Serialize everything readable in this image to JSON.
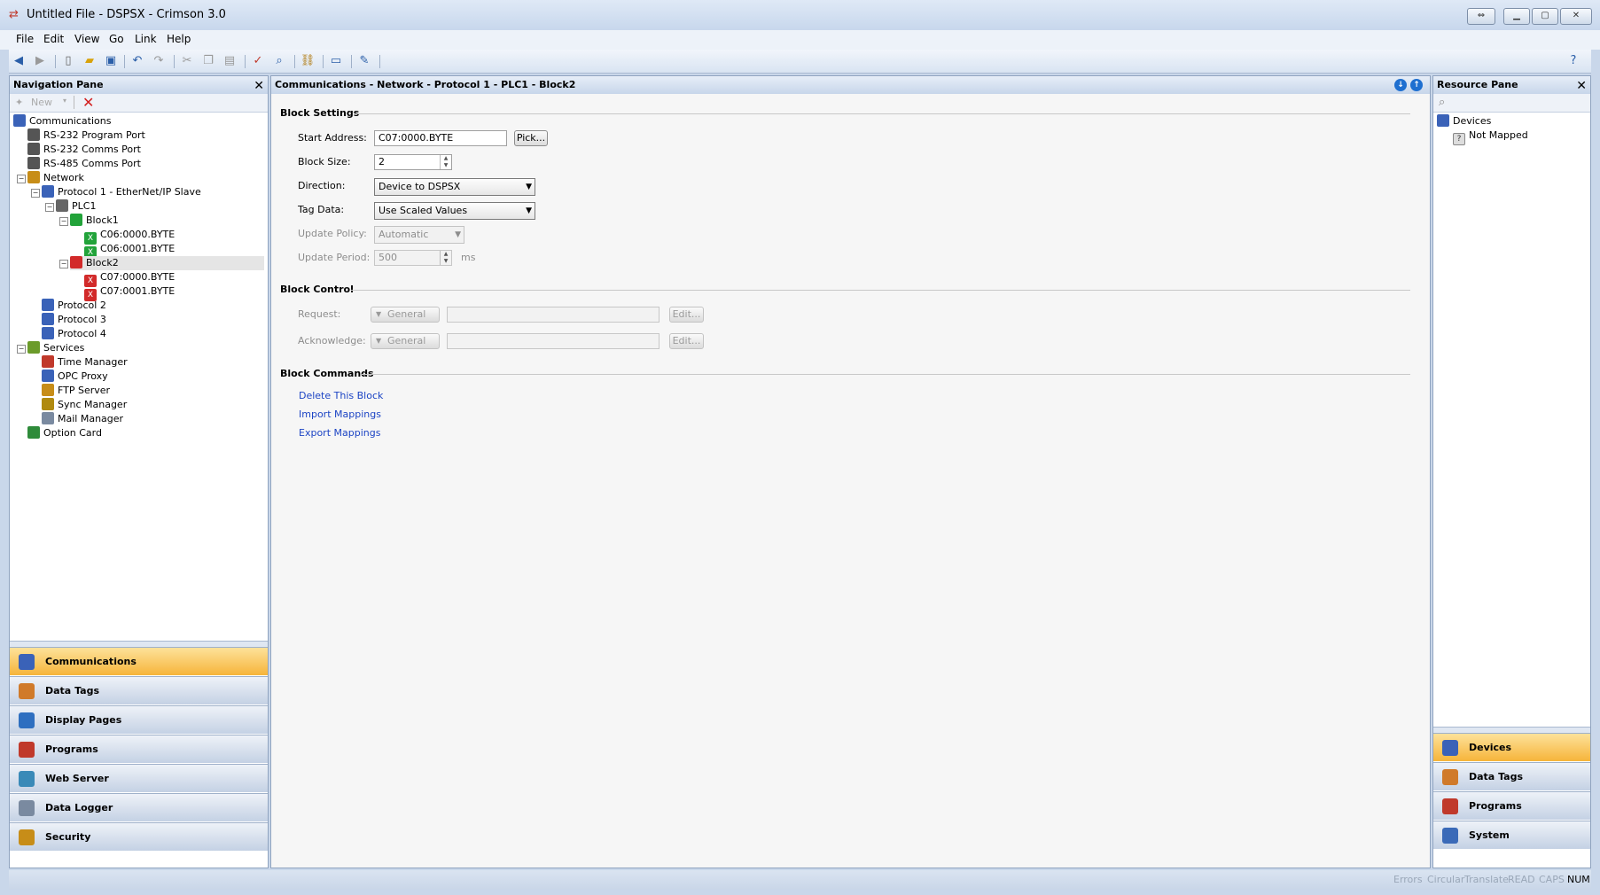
{
  "window": {
    "title": "Untitled File - DSPSX - Crimson 3.0"
  },
  "menu": [
    "File",
    "Edit",
    "View",
    "Go",
    "Link",
    "Help"
  ],
  "toolbar": {
    "icons": [
      "back-icon",
      "forward-icon",
      "new-file-icon",
      "open-folder-icon",
      "save-icon",
      "undo-icon",
      "redo-icon",
      "cut-icon",
      "copy-icon",
      "paste-icon",
      "spell-check-icon",
      "find-icon",
      "link-icon",
      "monitor-icon",
      "pencil-icon",
      "help-icon"
    ]
  },
  "nav_pane": {
    "title": "Navigation Pane",
    "new_label": "New",
    "tree": [
      {
        "label": "Communications",
        "level": 0,
        "icon": "comms-icon",
        "expander": ""
      },
      {
        "label": "RS-232 Program Port",
        "level": 1,
        "icon": "port-icon",
        "expander": ""
      },
      {
        "label": "RS-232 Comms Port",
        "level": 1,
        "icon": "port-icon",
        "expander": ""
      },
      {
        "label": "RS-485 Comms Port",
        "level": 1,
        "icon": "port-icon",
        "expander": ""
      },
      {
        "label": "Network",
        "level": 1,
        "icon": "network-icon",
        "expander": "−"
      },
      {
        "label": "Protocol 1 - EtherNet/IP Slave",
        "level": 2,
        "icon": "protocol-icon",
        "expander": "−"
      },
      {
        "label": "PLC1",
        "level": 3,
        "icon": "plc-icon",
        "expander": "−"
      },
      {
        "label": "Block1",
        "level": 4,
        "icon": "block-green-icon",
        "expander": "−"
      },
      {
        "label": "C06:0000.BYTE",
        "level": 5,
        "icon": "mapped-green-icon",
        "expander": ""
      },
      {
        "label": "C06:0001.BYTE",
        "level": 5,
        "icon": "mapped-green-icon",
        "expander": ""
      },
      {
        "label": "Block2",
        "level": 4,
        "icon": "block-red-icon",
        "expander": "−"
      },
      {
        "label": "C07:0000.BYTE",
        "level": 5,
        "icon": "mapped-red-icon",
        "expander": ""
      },
      {
        "label": "C07:0001.BYTE",
        "level": 5,
        "icon": "mapped-red-icon",
        "expander": ""
      },
      {
        "label": "Protocol 2",
        "level": 2,
        "icon": "protocol-icon",
        "expander": ""
      },
      {
        "label": "Protocol 3",
        "level": 2,
        "icon": "protocol-icon",
        "expander": ""
      },
      {
        "label": "Protocol 4",
        "level": 2,
        "icon": "protocol-icon",
        "expander": ""
      },
      {
        "label": "Services",
        "level": 1,
        "icon": "services-icon",
        "expander": "−"
      },
      {
        "label": "Time Manager",
        "level": 2,
        "icon": "clock-icon",
        "expander": ""
      },
      {
        "label": "OPC Proxy",
        "level": 2,
        "icon": "opc-icon",
        "expander": ""
      },
      {
        "label": "FTP Server",
        "level": 2,
        "icon": "ftp-icon",
        "expander": ""
      },
      {
        "label": "Sync Manager",
        "level": 2,
        "icon": "sync-icon",
        "expander": ""
      },
      {
        "label": "Mail Manager",
        "level": 2,
        "icon": "mail-icon",
        "expander": ""
      },
      {
        "label": "Option Card",
        "level": 1,
        "icon": "card-icon",
        "expander": ""
      }
    ],
    "categories": [
      "Communications",
      "Data Tags",
      "Display Pages",
      "Programs",
      "Web Server",
      "Data Logger",
      "Security"
    ]
  },
  "main": {
    "breadcrumb": "Communications - Network - Protocol 1 - PLC1 - Block2",
    "block_settings": {
      "title": "Block Settings",
      "start_address_label": "Start Address:",
      "start_address_value": "C07:0000.BYTE",
      "pick_label": "Pick...",
      "block_size_label": "Block Size:",
      "block_size_value": "2",
      "direction_label": "Direction:",
      "direction_value": "Device to DSPSX",
      "tag_data_label": "Tag Data:",
      "tag_data_value": "Use Scaled Values",
      "update_policy_label": "Update Policy:",
      "update_policy_value": "Automatic",
      "update_period_label": "Update Period:",
      "update_period_value": "500",
      "update_period_unit": "ms"
    },
    "block_control": {
      "title": "Block Control",
      "request_label": "Request:",
      "request_type": "General",
      "acknowledge_label": "Acknowledge:",
      "acknowledge_type": "General",
      "edit_label": "Edit..."
    },
    "block_commands": {
      "title": "Block Commands",
      "links": [
        "Delete This Block",
        "Import Mappings",
        "Export Mappings"
      ]
    }
  },
  "resource_pane": {
    "title": "Resource Pane",
    "tree": [
      {
        "label": "Devices"
      },
      {
        "label": "Not Mapped"
      }
    ],
    "categories": [
      "Devices",
      "Data Tags",
      "Programs",
      "System"
    ]
  },
  "status": [
    "Errors",
    "Circular",
    "Translate",
    "READ",
    "CAPS",
    "NUM"
  ]
}
